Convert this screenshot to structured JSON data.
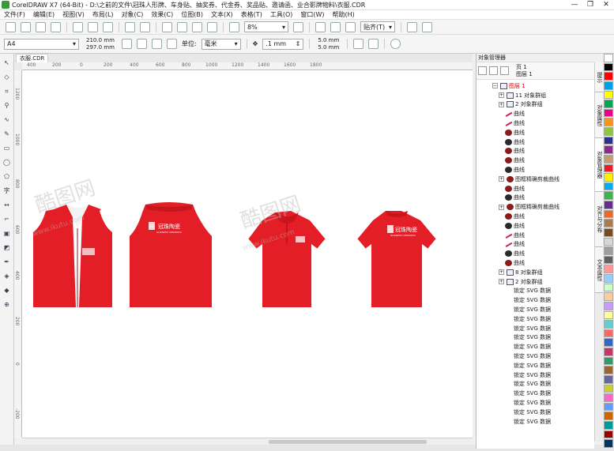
{
  "app": {
    "title": "CorelDRAW X7 (64-Bit) - D:\\之前的文件\\冠珠人形牌、车身贴、抽奖券、代金券、奖品贴、邀请函、业合影牌物料\\衣服.CDR",
    "window_controls": [
      "—",
      "❐",
      "✕"
    ]
  },
  "menu": [
    "文件(F)",
    "编辑(E)",
    "视图(V)",
    "布局(L)",
    "对象(C)",
    "效果(C)",
    "位图(B)",
    "文本(X)",
    "表格(T)",
    "工具(O)",
    "窗口(W)",
    "帮助(H)"
  ],
  "toolbar": {
    "zoom": "8%",
    "snap_label": "贴齐(T)"
  },
  "property_bar": {
    "page_size": "A4",
    "width": "210.0 mm",
    "height": "297.0 mm",
    "units_label": "单位:",
    "units": "毫米",
    "nudge": ".1 mm",
    "dup_x": "5.0 mm",
    "dup_y": "5.0 mm"
  },
  "document_tab": "衣服.CDR",
  "ruler": {
    "h_ticks": [
      "400",
      "200",
      "0",
      "200",
      "400",
      "600",
      "800",
      "1000",
      "1200",
      "1400",
      "1600",
      "1800"
    ],
    "v_ticks": [
      "1200",
      "1000",
      "800",
      "600",
      "400",
      "200",
      "0",
      "-200"
    ]
  },
  "canvas": {
    "brand_text": "冠珠陶瓷",
    "brand_sub": "GUANZHU CERAMICS",
    "watermark": "酷图网",
    "watermark_url": "www.ikutu.com",
    "shirt_color": "#e41e26"
  },
  "object_manager": {
    "header": "对象管理器",
    "page": "页 1",
    "layer": "图层 1",
    "rows": [
      {
        "label": "图层 1",
        "indent": 1,
        "expand": "−",
        "icon": "layer",
        "red": true
      },
      {
        "label": "11 对象群组",
        "indent": 2,
        "expand": "+",
        "icon": "group"
      },
      {
        "label": "2 对象群组",
        "indent": 2,
        "expand": "+",
        "icon": "group"
      },
      {
        "label": "曲线",
        "indent": 3,
        "icon": "line"
      },
      {
        "label": "曲线",
        "indent": 3,
        "icon": "line"
      },
      {
        "label": "曲线",
        "indent": 3,
        "icon": "ellipse"
      },
      {
        "label": "曲线",
        "indent": 3,
        "icon": "ellipse"
      },
      {
        "label": "曲线",
        "indent": 3,
        "icon": "ellipse"
      },
      {
        "label": "曲线",
        "indent": 3,
        "icon": "ellipse"
      },
      {
        "label": "曲线",
        "indent": 3,
        "icon": "ellipse"
      },
      {
        "label": "图框精确剪裁曲线",
        "indent": 2,
        "expand": "+",
        "icon": "ellipse"
      },
      {
        "label": "曲线",
        "indent": 3,
        "icon": "ellipse"
      },
      {
        "label": "曲线",
        "indent": 3,
        "icon": "ellipse"
      },
      {
        "label": "图框精确剪裁曲线",
        "indent": 2,
        "expand": "+",
        "icon": "ellipse"
      },
      {
        "label": "曲线",
        "indent": 3,
        "icon": "ellipse"
      },
      {
        "label": "曲线",
        "indent": 3,
        "icon": "ellipse"
      },
      {
        "label": "曲线",
        "indent": 3,
        "icon": "line"
      },
      {
        "label": "曲线",
        "indent": 3,
        "icon": "line"
      },
      {
        "label": "曲线",
        "indent": 3,
        "icon": "ellipse"
      },
      {
        "label": "曲线",
        "indent": 3,
        "icon": "ellipse"
      },
      {
        "label": "8 对象群组",
        "indent": 2,
        "expand": "+",
        "icon": "group"
      },
      {
        "label": "2 对象群组",
        "indent": 2,
        "expand": "+",
        "icon": "group"
      },
      {
        "label": "锁定 SVG 数据",
        "indent": 3,
        "icon": "svg"
      },
      {
        "label": "锁定 SVG 数据",
        "indent": 3,
        "icon": "svg"
      },
      {
        "label": "锁定 SVG 数据",
        "indent": 3,
        "icon": "svg"
      },
      {
        "label": "锁定 SVG 数据",
        "indent": 3,
        "icon": "svg"
      },
      {
        "label": "锁定 SVG 数据",
        "indent": 3,
        "icon": "svg"
      },
      {
        "label": "锁定 SVG 数据",
        "indent": 3,
        "icon": "svg"
      },
      {
        "label": "锁定 SVG 数据",
        "indent": 3,
        "icon": "svg"
      },
      {
        "label": "锁定 SVG 数据",
        "indent": 3,
        "icon": "svg"
      },
      {
        "label": "锁定 SVG 数据",
        "indent": 3,
        "icon": "svg"
      },
      {
        "label": "锁定 SVG 数据",
        "indent": 3,
        "icon": "svg"
      },
      {
        "label": "锁定 SVG 数据",
        "indent": 3,
        "icon": "svg"
      },
      {
        "label": "锁定 SVG 数据",
        "indent": 3,
        "icon": "svg"
      },
      {
        "label": "锁定 SVG 数据",
        "indent": 3,
        "icon": "svg"
      },
      {
        "label": "锁定 SVG 数据",
        "indent": 3,
        "icon": "svg"
      },
      {
        "label": "锁定 SVG 数据",
        "indent": 3,
        "icon": "svg"
      }
    ]
  },
  "right_tabs": [
    "提示",
    "对象属性",
    "对象管理器",
    "对齐与分布",
    "文本属性"
  ],
  "palette": [
    "#ffffff",
    "#000000",
    "#ff0000",
    "#00a0e9",
    "#ffff00",
    "#00a651",
    "#ec008c",
    "#f7941d",
    "#8dc63f",
    "#2e3192",
    "#92278f",
    "#c69c6d",
    "#ed1c24",
    "#fff200",
    "#00aeef",
    "#39b54a",
    "#662d91",
    "#f26522",
    "#a67c52",
    "#754c24",
    "#d7d7d7",
    "#9e9e9e",
    "#606060",
    "#ff9999",
    "#99ccff",
    "#ccffcc",
    "#ffcc99",
    "#cc99ff",
    "#ffff99",
    "#66cccc",
    "#ff6666",
    "#3366cc",
    "#cc3366",
    "#339966",
    "#996633",
    "#666699",
    "#cccc33",
    "#ff66cc",
    "#6699ff",
    "#cc6600",
    "#009999",
    "#990000",
    "#003366"
  ]
}
